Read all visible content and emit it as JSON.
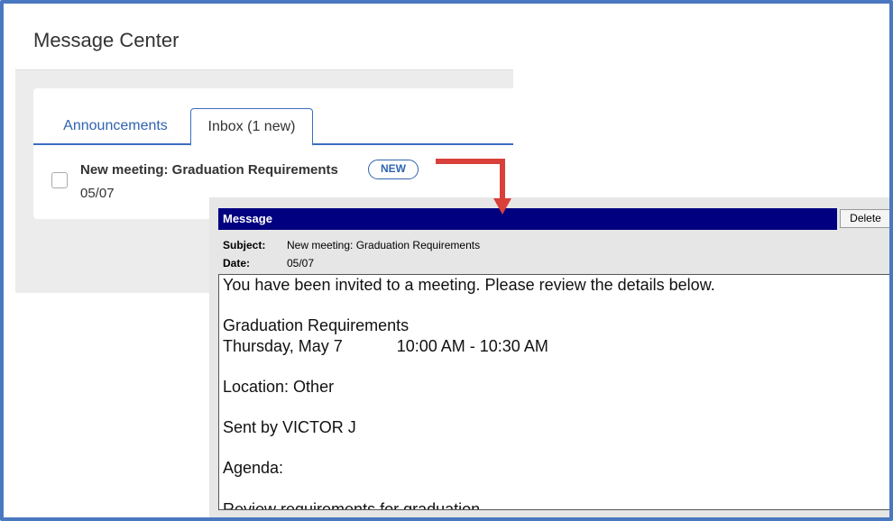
{
  "message_center": {
    "title": "Message Center",
    "tabs": [
      {
        "label": "Announcements"
      },
      {
        "label": "Inbox (1 new)"
      }
    ],
    "message": {
      "title": "New meeting: Graduation Requirements",
      "badge": "NEW",
      "date": "05/07"
    }
  },
  "popup": {
    "header": "Message",
    "delete_label": "Delete",
    "subject_label": "Subject:",
    "subject_value": "New meeting: Graduation Requirements",
    "date_label": "Date:",
    "date_value": "05/07",
    "body_lines": [
      "You have been invited to a meeting. Please review the details below.",
      "",
      "Graduation Requirements",
      "Thursday, May 7            10:00 AM - 10:30 AM",
      "",
      "Location: Other",
      "",
      "Sent by VICTOR J",
      "",
      "Agenda:",
      "",
      "Review requirements for graduation."
    ]
  },
  "colors": {
    "frame": "#4a78c0",
    "link": "#2f63b0",
    "title_bar": "#000080",
    "arrow": "#d9403a"
  }
}
